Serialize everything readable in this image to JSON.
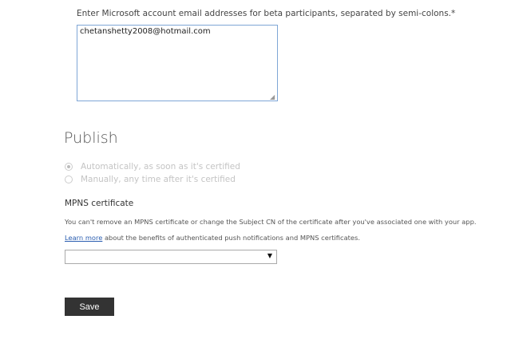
{
  "beta": {
    "label": "Enter Microsoft account email addresses for beta participants, separated by semi-colons.*",
    "value": "chetanshetty2008@hotmail.com"
  },
  "publish": {
    "title": "Publish",
    "options": [
      {
        "label": "Automatically, as soon as it's certified",
        "selected": true
      },
      {
        "label": "Manually, any time after it's certified",
        "selected": false
      }
    ]
  },
  "mpns": {
    "title": "MPNS certificate",
    "description": "You can't remove an MPNS certificate or change the Subject CN of the certificate after you've associated one with your app.",
    "learn_more_link": "Learn more",
    "learn_more_text": " about the benefits of authenticated push notifications and MPNS certificates.",
    "select_value": ""
  },
  "save_label": "Save"
}
